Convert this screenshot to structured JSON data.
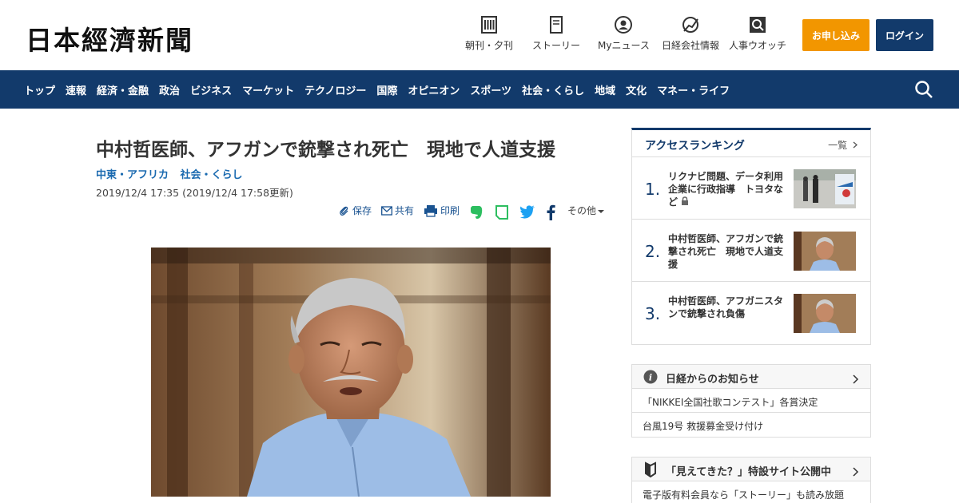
{
  "header": {
    "logo": "日本經濟新聞",
    "nav": [
      {
        "label": "朝刊・夕刊",
        "icon": "newspaper-icon"
      },
      {
        "label": "ストーリー",
        "icon": "book-icon"
      },
      {
        "label": "Myニュース",
        "icon": "person-icon"
      },
      {
        "label": "日経会社情報",
        "icon": "chart-icon"
      },
      {
        "label": "人事ウオッチ",
        "icon": "search-person-icon"
      }
    ],
    "subscribe_label": "お申し込み",
    "login_label": "ログイン"
  },
  "colors": {
    "brand": "#123a6b",
    "accent": "#f29600",
    "link": "#1a6ab0"
  },
  "navbar": {
    "items": [
      "トップ",
      "速報",
      "経済・金融",
      "政治",
      "ビジネス",
      "マーケット",
      "テクノロジー",
      "国際",
      "オピニオン",
      "スポーツ",
      "社会・くらし",
      "地域",
      "文化",
      "マネー・ライフ"
    ]
  },
  "article": {
    "title": "中村哲医師、アフガンで銃撃され死亡　現地で人道支援",
    "categories": [
      "中東・アフリカ",
      "社会・くらし"
    ],
    "date": "2019/12/4 17:35 (2019/12/4 17:58更新)",
    "share": {
      "save": "保存",
      "share": "共有",
      "print": "印刷",
      "more": "その他"
    }
  },
  "ranking": {
    "title": "アクセスランキング",
    "all_label": "一覧",
    "items": [
      {
        "rank": "1.",
        "text": "リクナビ問題、データ利用企業に行政指導　トヨタなど"
      },
      {
        "rank": "2.",
        "text": "中村哲医師、アフガンで銃撃され死亡　現地で人道支援"
      },
      {
        "rank": "3.",
        "text": "中村哲医師、アフガニスタンで銃撃され負傷"
      }
    ]
  },
  "notice": {
    "title": "日経からのお知らせ",
    "rows": [
      "「NIKKEI全国社歌コンテスト」各賞決定",
      "台風19号 救援募金受け付け"
    ]
  },
  "notice2": {
    "title": "「見えてきた？」特設サイト公開中",
    "rows": [
      "電子版有料会員なら「ストーリー」も読み放題"
    ]
  }
}
